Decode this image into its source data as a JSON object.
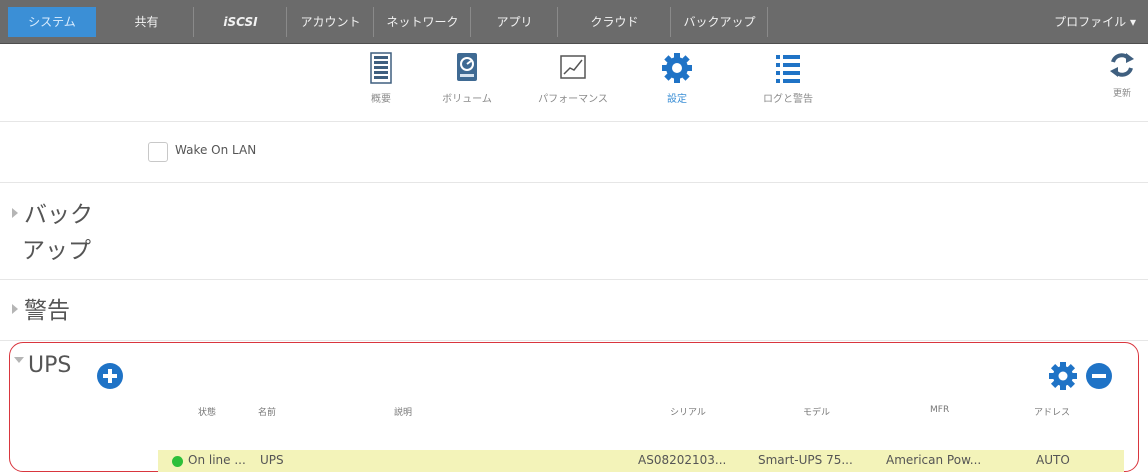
{
  "nav": {
    "tabs": [
      "システム",
      "共有",
      "iSCSI",
      "アカウント",
      "ネットワーク",
      "アプリ",
      "クラウド",
      "バックアップ"
    ],
    "profile": "プロファイル ▾"
  },
  "toolbar": {
    "items": [
      "概要",
      "ボリューム",
      "パフォーマンス",
      "設定",
      "ログと警告"
    ],
    "refresh": "更新"
  },
  "wol": {
    "label": "Wake On LAN"
  },
  "sections": {
    "backup_line1": "バック",
    "backup_line2": "アップ",
    "alerts": "警告"
  },
  "ups": {
    "title": "UPS",
    "columns": [
      "状態",
      "名前",
      "説明",
      "シリアル",
      "モデル",
      "MFR",
      "アドレス"
    ],
    "row": {
      "status": "On line ...",
      "name": "UPS",
      "description": "",
      "serial": "AS08202103...",
      "model": "Smart-UPS 75...",
      "mfr": "American Pow...",
      "address": "AUTO"
    }
  },
  "colors": {
    "accent": "#3b8fd6",
    "nav_bg": "#6b6b6b",
    "ups_border": "#d9363e",
    "row_bg": "#f3f3b9",
    "status_ok": "#2dbf3a"
  }
}
